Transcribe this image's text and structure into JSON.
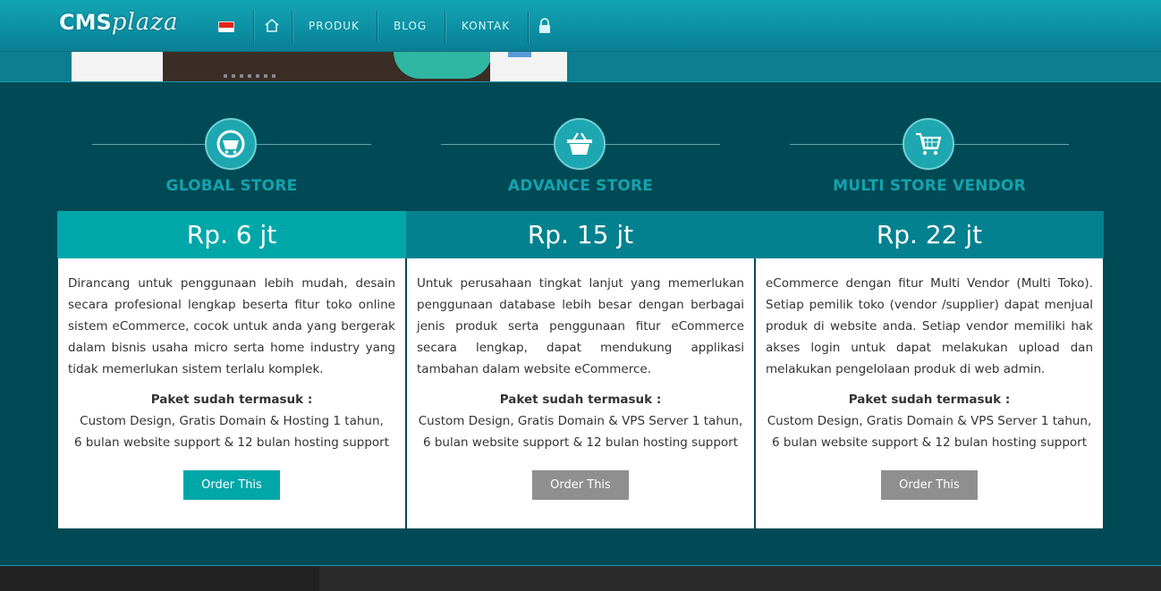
{
  "header": {
    "logo_a": "CMS",
    "logo_b": "plaza",
    "nav": [
      "PRODUK",
      "BLOG",
      "KONTAK"
    ]
  },
  "colors": {
    "accent": "#00a7a9",
    "accent_dark": "#03818f",
    "section_bg": "#004a55",
    "button_grey": "#8f8f8f"
  },
  "plans": [
    {
      "icon": "globe-cart-icon",
      "title": "GLOBAL STORE",
      "price": "Rp. 6 jt",
      "description": "Dirancang untuk penggunaan lebih mudah, desain secara profesional lengkap beserta fitur toko online sistem eCommerce, cocok untuk anda yang bergerak dalam bisnis usaha micro serta home industry yang tidak memerlukan sistem  terlalu komplek.",
      "includes_title": "Paket sudah termasuk :",
      "includes_line1": "Custom Design, Gratis Domain & Hosting 1 tahun,",
      "includes_line2": "6 bulan website support & 12 bulan hosting support",
      "button": "Order This"
    },
    {
      "icon": "basket-icon",
      "title": "ADVANCE STORE",
      "price": "Rp. 15 jt",
      "description": "Untuk perusahaan tingkat lanjut yang memerlukan penggunaan database lebih besar dengan berbagai jenis produk serta penggunaan fitur eCommerce secara lengkap, dapat mendukung applikasi tambahan dalam website eCommerce.",
      "includes_title": "Paket sudah termasuk :",
      "includes_line1": "Custom Design, Gratis Domain & VPS Server 1 tahun,",
      "includes_line2": "6 bulan website support & 12 bulan hosting support",
      "button": "Order This"
    },
    {
      "icon": "shopping-cart-icon",
      "title": "MULTI STORE VENDOR",
      "price": "Rp. 22 jt",
      "description": "eCommerce dengan fitur Multi Vendor (Multi Toko). Setiap pemilik toko (vendor /supplier) dapat menjual produk di website anda. Setiap vendor memiliki hak akses login untuk dapat melakukan upload dan melakukan pengelolaan produk di web admin.",
      "includes_title": "Paket sudah termasuk :",
      "includes_line1": "Custom Design, Gratis Domain & VPS Server 1 tahun,",
      "includes_line2": "6 bulan website support & 12 bulan hosting support",
      "button": "Order This"
    }
  ]
}
